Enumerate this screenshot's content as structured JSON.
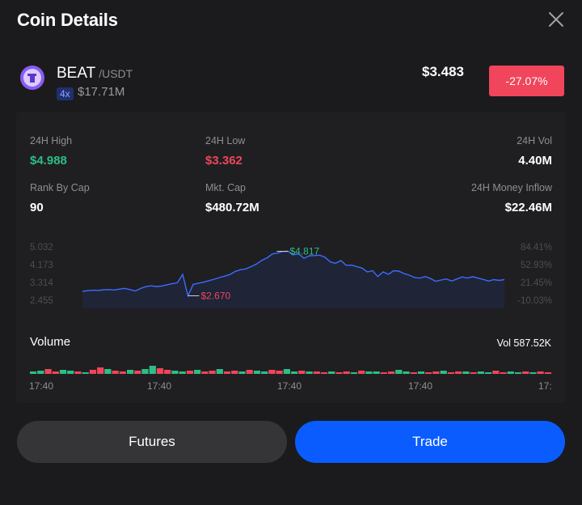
{
  "header": {
    "title": "Coin Details"
  },
  "coin": {
    "symbol": "BEAT",
    "quote": "/USDT",
    "leverage": "4x",
    "volume_small": "$17.71M",
    "price": "$3.483",
    "change": "-27.07%"
  },
  "stats": {
    "high_label": "24H High",
    "high_value": "$4.988",
    "low_label": "24H Low",
    "low_value": "$3.362",
    "vol_label": "24H Vol",
    "vol_value": "4.40M",
    "rank_label": "Rank By Cap",
    "rank_value": "90",
    "mktcap_label": "Mkt. Cap",
    "mktcap_value": "$480.72M",
    "inflow_label": "24H Money Inflow",
    "inflow_value": "$22.46M"
  },
  "chart_data": {
    "type": "line",
    "y_left_ticks": [
      "5.032",
      "4.173",
      "3.314",
      "2.455"
    ],
    "y_right_ticks": [
      "84.41%",
      "52.93%",
      "21.45%",
      "-10.03%"
    ],
    "ylim": [
      2.455,
      5.032
    ],
    "high_marker": "$4.817",
    "low_marker": "$2.670",
    "series": [
      {
        "values": [
          2.88,
          2.92,
          2.94,
          2.93,
          2.96,
          2.97,
          2.95,
          2.99,
          3.03,
          2.97,
          2.9,
          3.02,
          3.11,
          3.15,
          3.12,
          3.14,
          3.2,
          3.25,
          3.3,
          3.7,
          2.67,
          3.22,
          3.28,
          3.33,
          3.4,
          3.47,
          3.55,
          3.62,
          3.7,
          3.85,
          3.93,
          3.97,
          4.08,
          4.2,
          4.38,
          4.5,
          4.69,
          4.73,
          4.81,
          4.817,
          4.65,
          4.69,
          4.48,
          4.6,
          4.61,
          4.63,
          4.53,
          4.3,
          4.24,
          4.37,
          4.14,
          4.15,
          4.08,
          4.01,
          3.82,
          3.88,
          3.6,
          3.82,
          3.71,
          3.88,
          3.86,
          3.74,
          3.66,
          3.55,
          3.52,
          3.6,
          3.5,
          3.37,
          3.43,
          3.48,
          3.38,
          3.48,
          3.58,
          3.53,
          3.59,
          3.52,
          3.46,
          3.38,
          3.45,
          3.41,
          3.45
        ]
      }
    ]
  },
  "volume": {
    "title": "Volume",
    "total": "Vol 587.52K",
    "bars": [
      0.3,
      0.4,
      0.6,
      0.3,
      0.5,
      0.4,
      0.3,
      0.2,
      0.5,
      0.8,
      0.6,
      0.4,
      0.3,
      0.5,
      0.4,
      0.6,
      1.0,
      0.7,
      0.5,
      0.4,
      0.3,
      0.4,
      0.5,
      0.3,
      0.4,
      0.6,
      0.3,
      0.4,
      0.3,
      0.5,
      0.4,
      0.3,
      0.5,
      0.4,
      0.6,
      0.3,
      0.4,
      0.3,
      0.3,
      0.2,
      0.3,
      0.2,
      0.3,
      0.2,
      0.4,
      0.3,
      0.3,
      0.2,
      0.3,
      0.5,
      0.3,
      0.2,
      0.3,
      0.2,
      0.3,
      0.4,
      0.2,
      0.3,
      0.3,
      0.2,
      0.3,
      0.2,
      0.4,
      0.2,
      0.3,
      0.2,
      0.3,
      0.2,
      0.3,
      0.2
    ],
    "up_color": "#2ebd85",
    "down_color": "#f0455a"
  },
  "times": [
    "17:40",
    "17:40",
    "17:40",
    "17:40",
    "17:"
  ],
  "buttons": {
    "futures": "Futures",
    "trade": "Trade"
  },
  "colors": {
    "accent": "#0a5cff",
    "line": "#3b6cff",
    "negative": "#f0455a",
    "positive": "#2ebd85"
  }
}
